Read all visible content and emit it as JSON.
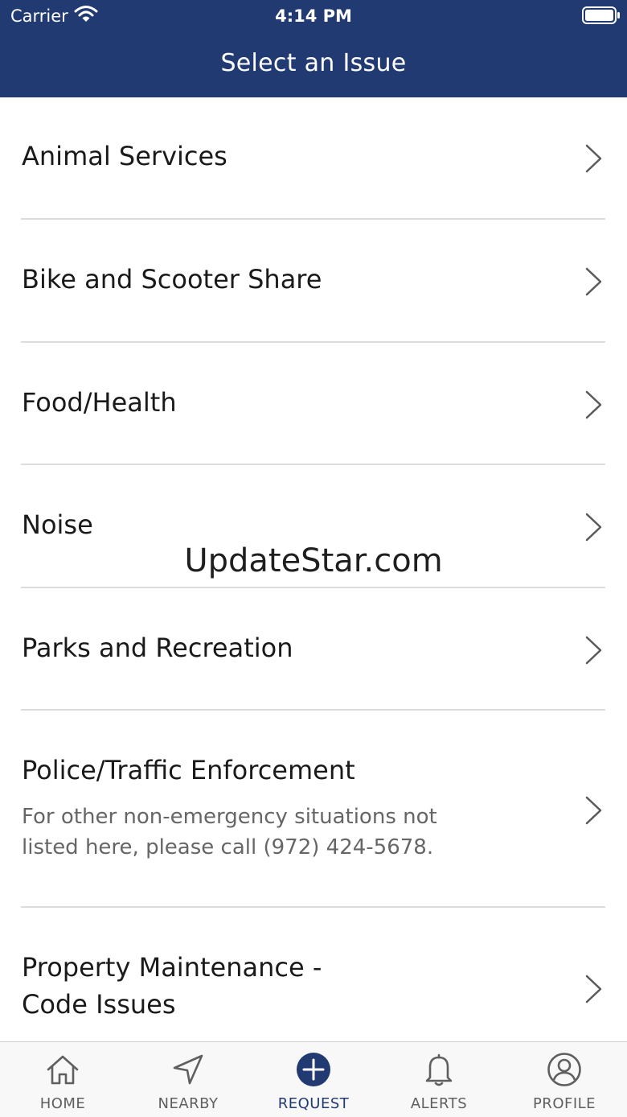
{
  "status_bar": {
    "carrier": "Carrier",
    "time": "4:14 PM"
  },
  "nav": {
    "title": "Select an Issue"
  },
  "issues": [
    {
      "title": "Animal Services"
    },
    {
      "title": "Bike and Scooter Share"
    },
    {
      "title": "Food/Health"
    },
    {
      "title": "Noise"
    },
    {
      "title": "Parks and Recreation"
    },
    {
      "title": "Police/Traffic Enforcement",
      "description_line1": "For other non-emergency situations not",
      "description_line2": "listed here, please call (972) 424-5678."
    },
    {
      "title_line1": "Property Maintenance -",
      "title_line2": "Code Issues"
    }
  ],
  "watermark": "UpdateStar.com",
  "tabbar": {
    "active_tab": "REQUEST",
    "active_color": "#213a72",
    "tabs": [
      {
        "label": "HOME",
        "icon": "home-icon"
      },
      {
        "label": "NEARBY",
        "icon": "location-arrow-icon"
      },
      {
        "label": "REQUEST",
        "icon": "plus-circle-icon"
      },
      {
        "label": "ALERTS",
        "icon": "bell-icon"
      },
      {
        "label": "PROFILE",
        "icon": "profile-icon"
      }
    ]
  },
  "colors": {
    "header_bg": "#213a72",
    "divider": "#dcdcdc",
    "description_text": "#666666"
  }
}
